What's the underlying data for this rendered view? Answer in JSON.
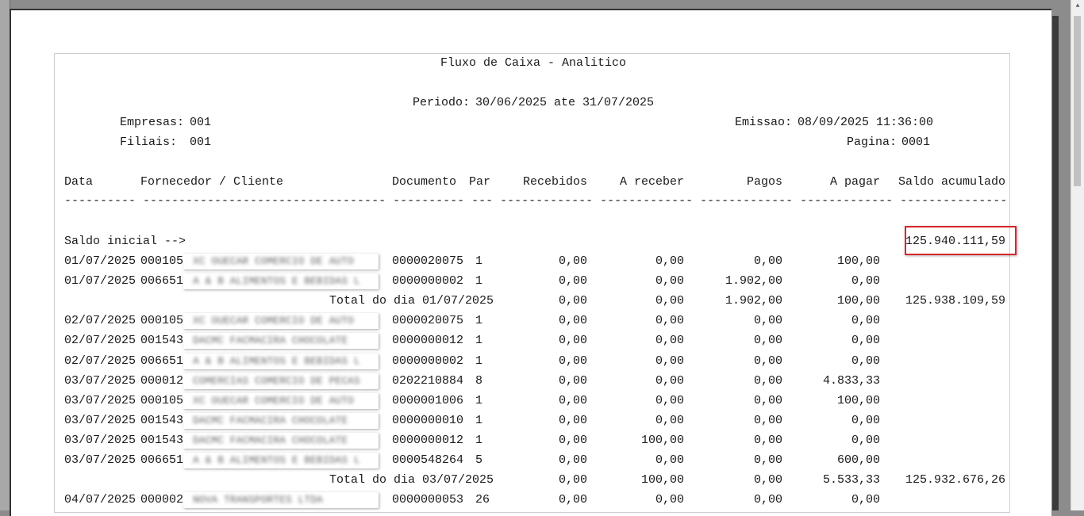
{
  "report": {
    "title": "Fluxo de Caixa - Analitico",
    "periodo_label": "Periodo:",
    "periodo_value": "30/06/2025 ate 31/07/2025",
    "empresas_label": "Empresas:",
    "empresas_value": "001",
    "filiais_label": "Filiais:",
    "filiais_value": "001",
    "emissao_label": "Emissao:",
    "emissao_value": "08/09/2025 11:36:00",
    "pagina_label": "Pagina:",
    "pagina_value": "0001"
  },
  "columns": {
    "data": "Data",
    "fornecedor": "Fornecedor / Cliente",
    "documento": "Documento",
    "par": "Par",
    "recebidos": "Recebidos",
    "a_receber": "A receber",
    "pagos": "Pagos",
    "a_pagar": "A pagar",
    "saldo": "Saldo acumulado"
  },
  "separator": "---------- ---------------------------------- ---------- --- ------------- ------------- ------------- ------------- ----------------",
  "saldo_inicial": {
    "label": "Saldo inicial -->",
    "value": "125.940.111,59"
  },
  "rows": [
    {
      "type": "line",
      "data": "01/07/2025",
      "codigo": "000105",
      "nome": "XC OUECAR COMERCIO DE AUTO",
      "documento": "0000020075",
      "par": "1",
      "recebidos": "0,00",
      "a_receber": "0,00",
      "pagos": "0,00",
      "a_pagar": "100,00"
    },
    {
      "type": "line",
      "data": "01/07/2025",
      "codigo": "006651",
      "nome": "A & B ALIMENTOS E BEBIDAS L",
      "documento": "0000000002",
      "par": "1",
      "recebidos": "0,00",
      "a_receber": "0,00",
      "pagos": "1.902,00",
      "a_pagar": "0,00"
    },
    {
      "type": "total",
      "label": "Total do dia 01/07/2025",
      "recebidos": "0,00",
      "a_receber": "0,00",
      "pagos": "1.902,00",
      "a_pagar": "100,00",
      "saldo": "125.938.109,59"
    },
    {
      "type": "line",
      "data": "02/07/2025",
      "codigo": "000105",
      "nome": "XC OUECAR COMERCIO DE AUTO",
      "documento": "0000020075",
      "par": "1",
      "recebidos": "0,00",
      "a_receber": "0,00",
      "pagos": "0,00",
      "a_pagar": "0,00"
    },
    {
      "type": "line",
      "data": "02/07/2025",
      "codigo": "001543",
      "nome": "DACMC FACMACIRA CHOCOLATE",
      "documento": "0000000012",
      "par": "1",
      "recebidos": "0,00",
      "a_receber": "0,00",
      "pagos": "0,00",
      "a_pagar": "0,00"
    },
    {
      "type": "line",
      "data": "02/07/2025",
      "codigo": "006651",
      "nome": "A & B ALIMENTOS E BEBIDAS L",
      "documento": "0000000002",
      "par": "1",
      "recebidos": "0,00",
      "a_receber": "0,00",
      "pagos": "0,00",
      "a_pagar": "0,00"
    },
    {
      "type": "line",
      "data": "03/07/2025",
      "codigo": "000012",
      "nome": "COMERCIAS COMERCIO DE PECAS",
      "documento": "0202210884",
      "par": "8",
      "recebidos": "0,00",
      "a_receber": "0,00",
      "pagos": "0,00",
      "a_pagar": "4.833,33"
    },
    {
      "type": "line",
      "data": "03/07/2025",
      "codigo": "000105",
      "nome": "XC OUECAR COMERCIO DE AUTO",
      "documento": "0000001006",
      "par": "1",
      "recebidos": "0,00",
      "a_receber": "0,00",
      "pagos": "0,00",
      "a_pagar": "100,00"
    },
    {
      "type": "line",
      "data": "03/07/2025",
      "codigo": "001543",
      "nome": "DACMC FACMACIRA CHOCOLATE",
      "documento": "0000000010",
      "par": "1",
      "recebidos": "0,00",
      "a_receber": "0,00",
      "pagos": "0,00",
      "a_pagar": "0,00"
    },
    {
      "type": "line",
      "data": "03/07/2025",
      "codigo": "001543",
      "nome": "DACMC FACMACIRA CHOCOLATE",
      "documento": "0000000012",
      "par": "1",
      "recebidos": "0,00",
      "a_receber": "100,00",
      "pagos": "0,00",
      "a_pagar": "0,00"
    },
    {
      "type": "line",
      "data": "03/07/2025",
      "codigo": "006651",
      "nome": "A & B ALIMENTOS E BEBIDAS L",
      "documento": "0000548264",
      "par": "5",
      "recebidos": "0,00",
      "a_receber": "0,00",
      "pagos": "0,00",
      "a_pagar": "600,00"
    },
    {
      "type": "total",
      "label": "Total do dia 03/07/2025",
      "recebidos": "0,00",
      "a_receber": "100,00",
      "pagos": "0,00",
      "a_pagar": "5.533,33",
      "saldo": "125.932.676,26"
    },
    {
      "type": "line",
      "data": "04/07/2025",
      "codigo": "000002",
      "nome": "NOVA TRANSPORTES LTDA",
      "documento": "0000000053",
      "par": "26",
      "recebidos": "0,00",
      "a_receber": "0,00",
      "pagos": "0,00",
      "a_pagar": "0,00"
    }
  ],
  "colors": {
    "highlight_border": "#d9262c",
    "viewer_background": "#8c8c8c"
  }
}
